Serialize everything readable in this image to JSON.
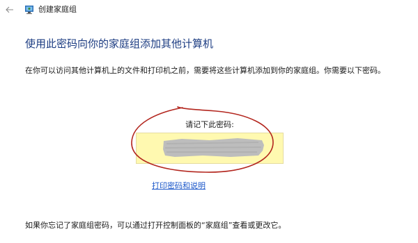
{
  "window": {
    "title": "创建家庭组",
    "back_icon": "back-arrow-icon",
    "app_icon": "homegroup-icon"
  },
  "main": {
    "heading": "使用此密码向你的家庭组添加其他计算机",
    "intro": "在你可以访问其他计算机上的文件和打印机之前，需要将这些计算机添加到你的家庭组。你需要以下密码。",
    "password_label": "请记下此密码:",
    "password_value_redacted": true,
    "print_link": "打印密码和说明",
    "footer_note": "如果你忘记了家庭组密码，可以通过打开控制面板的“家庭组”查看或更改它。"
  },
  "colors": {
    "heading": "#1c3c82",
    "link": "#1a56c9",
    "password_box": "#fff9b0",
    "redaction": "#bdbdbd",
    "annotation_circle": "#b3261e"
  }
}
